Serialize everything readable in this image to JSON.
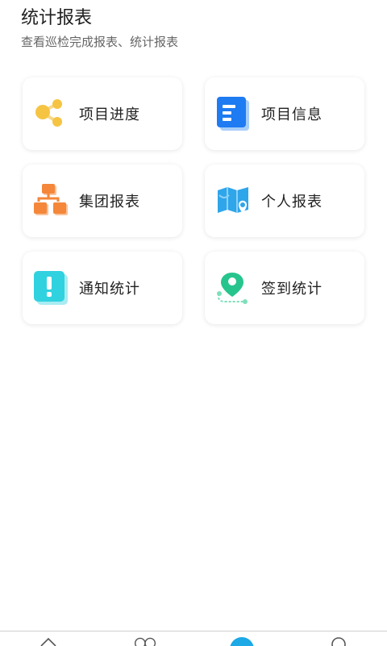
{
  "header": {
    "title": "统计报表",
    "subtitle": "查看巡检完成报表、统计报表"
  },
  "cards": [
    {
      "label": "项目进度",
      "icon": "share-nodes-icon"
    },
    {
      "label": "项目信息",
      "icon": "document-icon"
    },
    {
      "label": "集团报表",
      "icon": "org-chart-icon"
    },
    {
      "label": "个人报表",
      "icon": "map-pin-icon"
    },
    {
      "label": "通知统计",
      "icon": "exclamation-icon"
    },
    {
      "label": "签到统计",
      "icon": "location-route-icon"
    }
  ],
  "colors": {
    "yellow": "#F6C443",
    "blue": "#1E7BF2",
    "orange": "#F4873A",
    "sky": "#2FA5EA",
    "cyan": "#31D2E0",
    "green": "#27C58D",
    "tab_active": "#1CA9E6"
  },
  "bottom_nav": {
    "items": [
      "home-icon",
      "people-icon",
      "stats-icon",
      "profile-icon"
    ],
    "active_index": 2
  }
}
